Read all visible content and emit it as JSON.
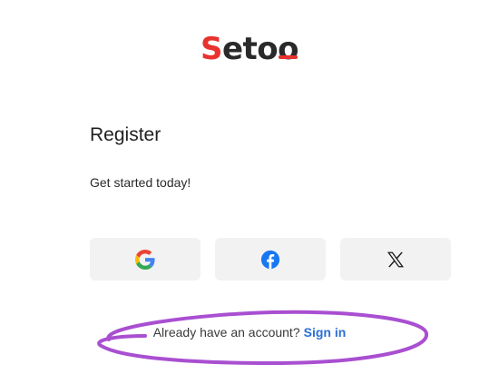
{
  "brand": {
    "logo_text_s": "S",
    "logo_text_mid": "eto",
    "logo_text_o": "o",
    "accent_color": "#e8322e"
  },
  "form": {
    "title": "Register",
    "subtitle": "Get started today!"
  },
  "social": [
    {
      "name": "google",
      "icon": "google-icon"
    },
    {
      "name": "facebook",
      "icon": "facebook-icon"
    },
    {
      "name": "x",
      "icon": "x-icon"
    }
  ],
  "footer": {
    "prompt": "Already have an account?",
    "link_label": "Sign in",
    "link_color": "#2b6fd6"
  },
  "annotation": {
    "color": "#a94fd1"
  }
}
